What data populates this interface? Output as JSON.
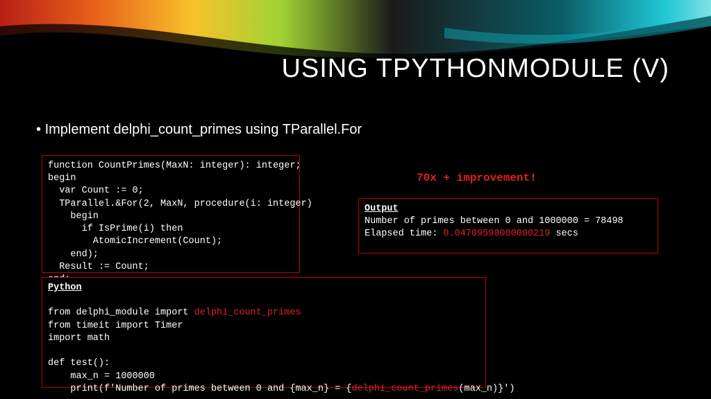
{
  "title": "USING TPYTHONMODULE (V)",
  "bullet": "Implement delphi_count_primes using TParallel.For",
  "callout": "70x + improvement!",
  "delphi": {
    "l1": "function CountPrimes(MaxN: integer): integer;",
    "l2": "begin",
    "l3": "  var Count := 0;",
    "l4": "  TParallel.&For(2, MaxN, procedure(i: integer)",
    "l5": "    begin",
    "l6": "      if IsPrime(i) then",
    "l7": "        AtomicIncrement(Count);",
    "l8": "    end);",
    "l9": "  Result := Count;",
    "l10": "end;"
  },
  "python": {
    "label": "Python",
    "l1a": "from delphi_module import ",
    "l1b": "delphi_count_primes",
    "l2": "from timeit import Timer",
    "l3": "import math",
    "l4": "def test():",
    "l5": "    max_n = 1000000",
    "l6a": "    print(f'Number of primes between 0 and {max_n} = {",
    "l6b": "delphi_count_primes",
    "l6c": "(max_n)}')"
  },
  "output": {
    "label": "Output",
    "l1": "Number of primes between 0 and 1000000 = 78498",
    "l2a": "Elapsed time: ",
    "l2b": "0.04709590000000219",
    "l2c": " secs"
  }
}
